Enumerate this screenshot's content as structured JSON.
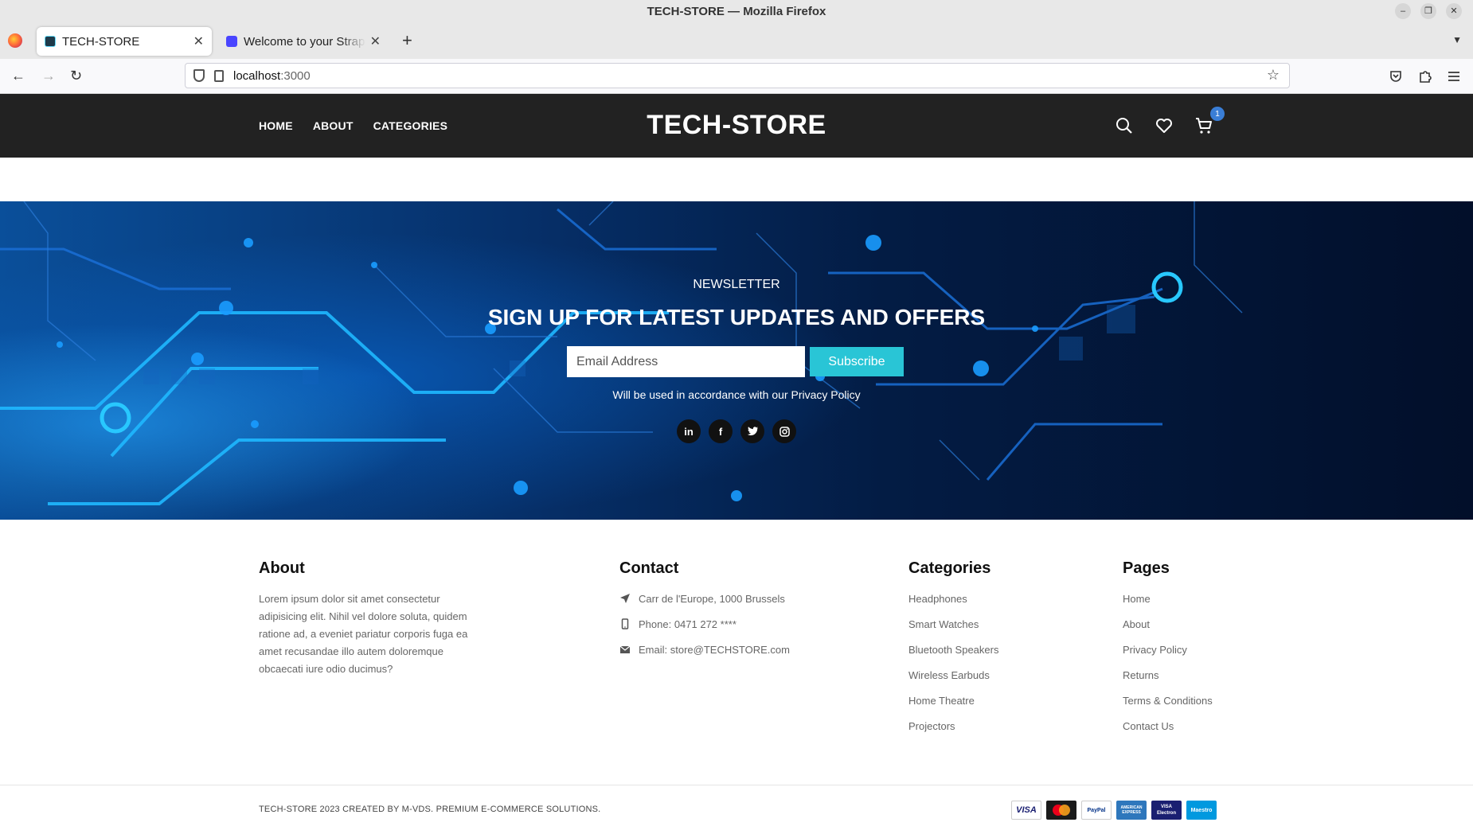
{
  "browser": {
    "window_title": "TECH-STORE — Mozilla Firefox",
    "tabs": [
      {
        "label": "TECH-STORE",
        "favicon": "react-icon",
        "active": true
      },
      {
        "label": "Welcome to your Strapi app",
        "favicon": "strapi-icon",
        "active": false
      }
    ],
    "url_host": "localhost",
    "url_port": ":3000"
  },
  "header": {
    "nav": [
      "HOME",
      "ABOUT",
      "CATEGORIES"
    ],
    "brand": "TECH-STORE",
    "cart_count": "1",
    "icons": [
      "search-icon",
      "heart-icon",
      "cart-icon"
    ]
  },
  "newsletter": {
    "eyebrow": "NEWSLETTER",
    "heading": "SIGN UP FOR LATEST UPDATES AND OFFERS",
    "email_placeholder": "Email Address",
    "subscribe_label": "Subscribe",
    "note": "Will be used in accordance with our Privacy Policy",
    "social": [
      {
        "name": "linkedin-icon",
        "glyph": "in"
      },
      {
        "name": "facebook-icon",
        "glyph": "f"
      },
      {
        "name": "twitter-icon",
        "glyph": "t"
      },
      {
        "name": "instagram-icon",
        "glyph": "◎"
      }
    ]
  },
  "footer": {
    "about": {
      "title": "About",
      "text": "Lorem ipsum dolor sit amet consectetur adipisicing elit. Nihil vel dolore soluta, quidem ratione ad, a eveniet pariatur corporis fuga ea amet recusandae illo autem doloremque obcaecati iure odio ducimus?"
    },
    "contact": {
      "title": "Contact",
      "items": [
        {
          "icon": "location-arrow-icon",
          "text": "Carr de l'Europe, 1000 Brussels"
        },
        {
          "icon": "mobile-phone-icon",
          "text": "Phone: 0471 272 ****"
        },
        {
          "icon": "envelope-icon",
          "text": "Email: store@TECHSTORE.com"
        }
      ]
    },
    "categories": {
      "title": "Categories",
      "items": [
        "Headphones",
        "Smart Watches",
        "Bluetooth Speakers",
        "Wireless Earbuds",
        "Home Theatre",
        "Projectors"
      ]
    },
    "pages": {
      "title": "Pages",
      "items": [
        "Home",
        "About",
        "Privacy Policy",
        "Returns",
        "Terms & Conditions",
        "Contact Us"
      ]
    },
    "copyright": "TECH-STORE 2023 CREATED BY M-VDS. PREMIUM E-COMMERCE SOLUTIONS.",
    "payments": [
      {
        "name": "visa-icon",
        "label": "VISA",
        "color": "#1a1f71"
      },
      {
        "name": "mastercard-icon",
        "label": "",
        "color": "#eb001b"
      },
      {
        "name": "paypal-icon",
        "label": "PayPal",
        "color": "#003087"
      },
      {
        "name": "amex-icon",
        "label": "AMERICAN EXPRESS",
        "color": "#2e77bc"
      },
      {
        "name": "visa-electron-icon",
        "label": "VISA Electron",
        "color": "#1a1f71"
      },
      {
        "name": "maestro-icon",
        "label": "Maestro",
        "color": "#0099df"
      }
    ]
  },
  "colors": {
    "header_bg": "#222222",
    "accent": "#29c5d6",
    "badge": "#3a7ed6"
  }
}
